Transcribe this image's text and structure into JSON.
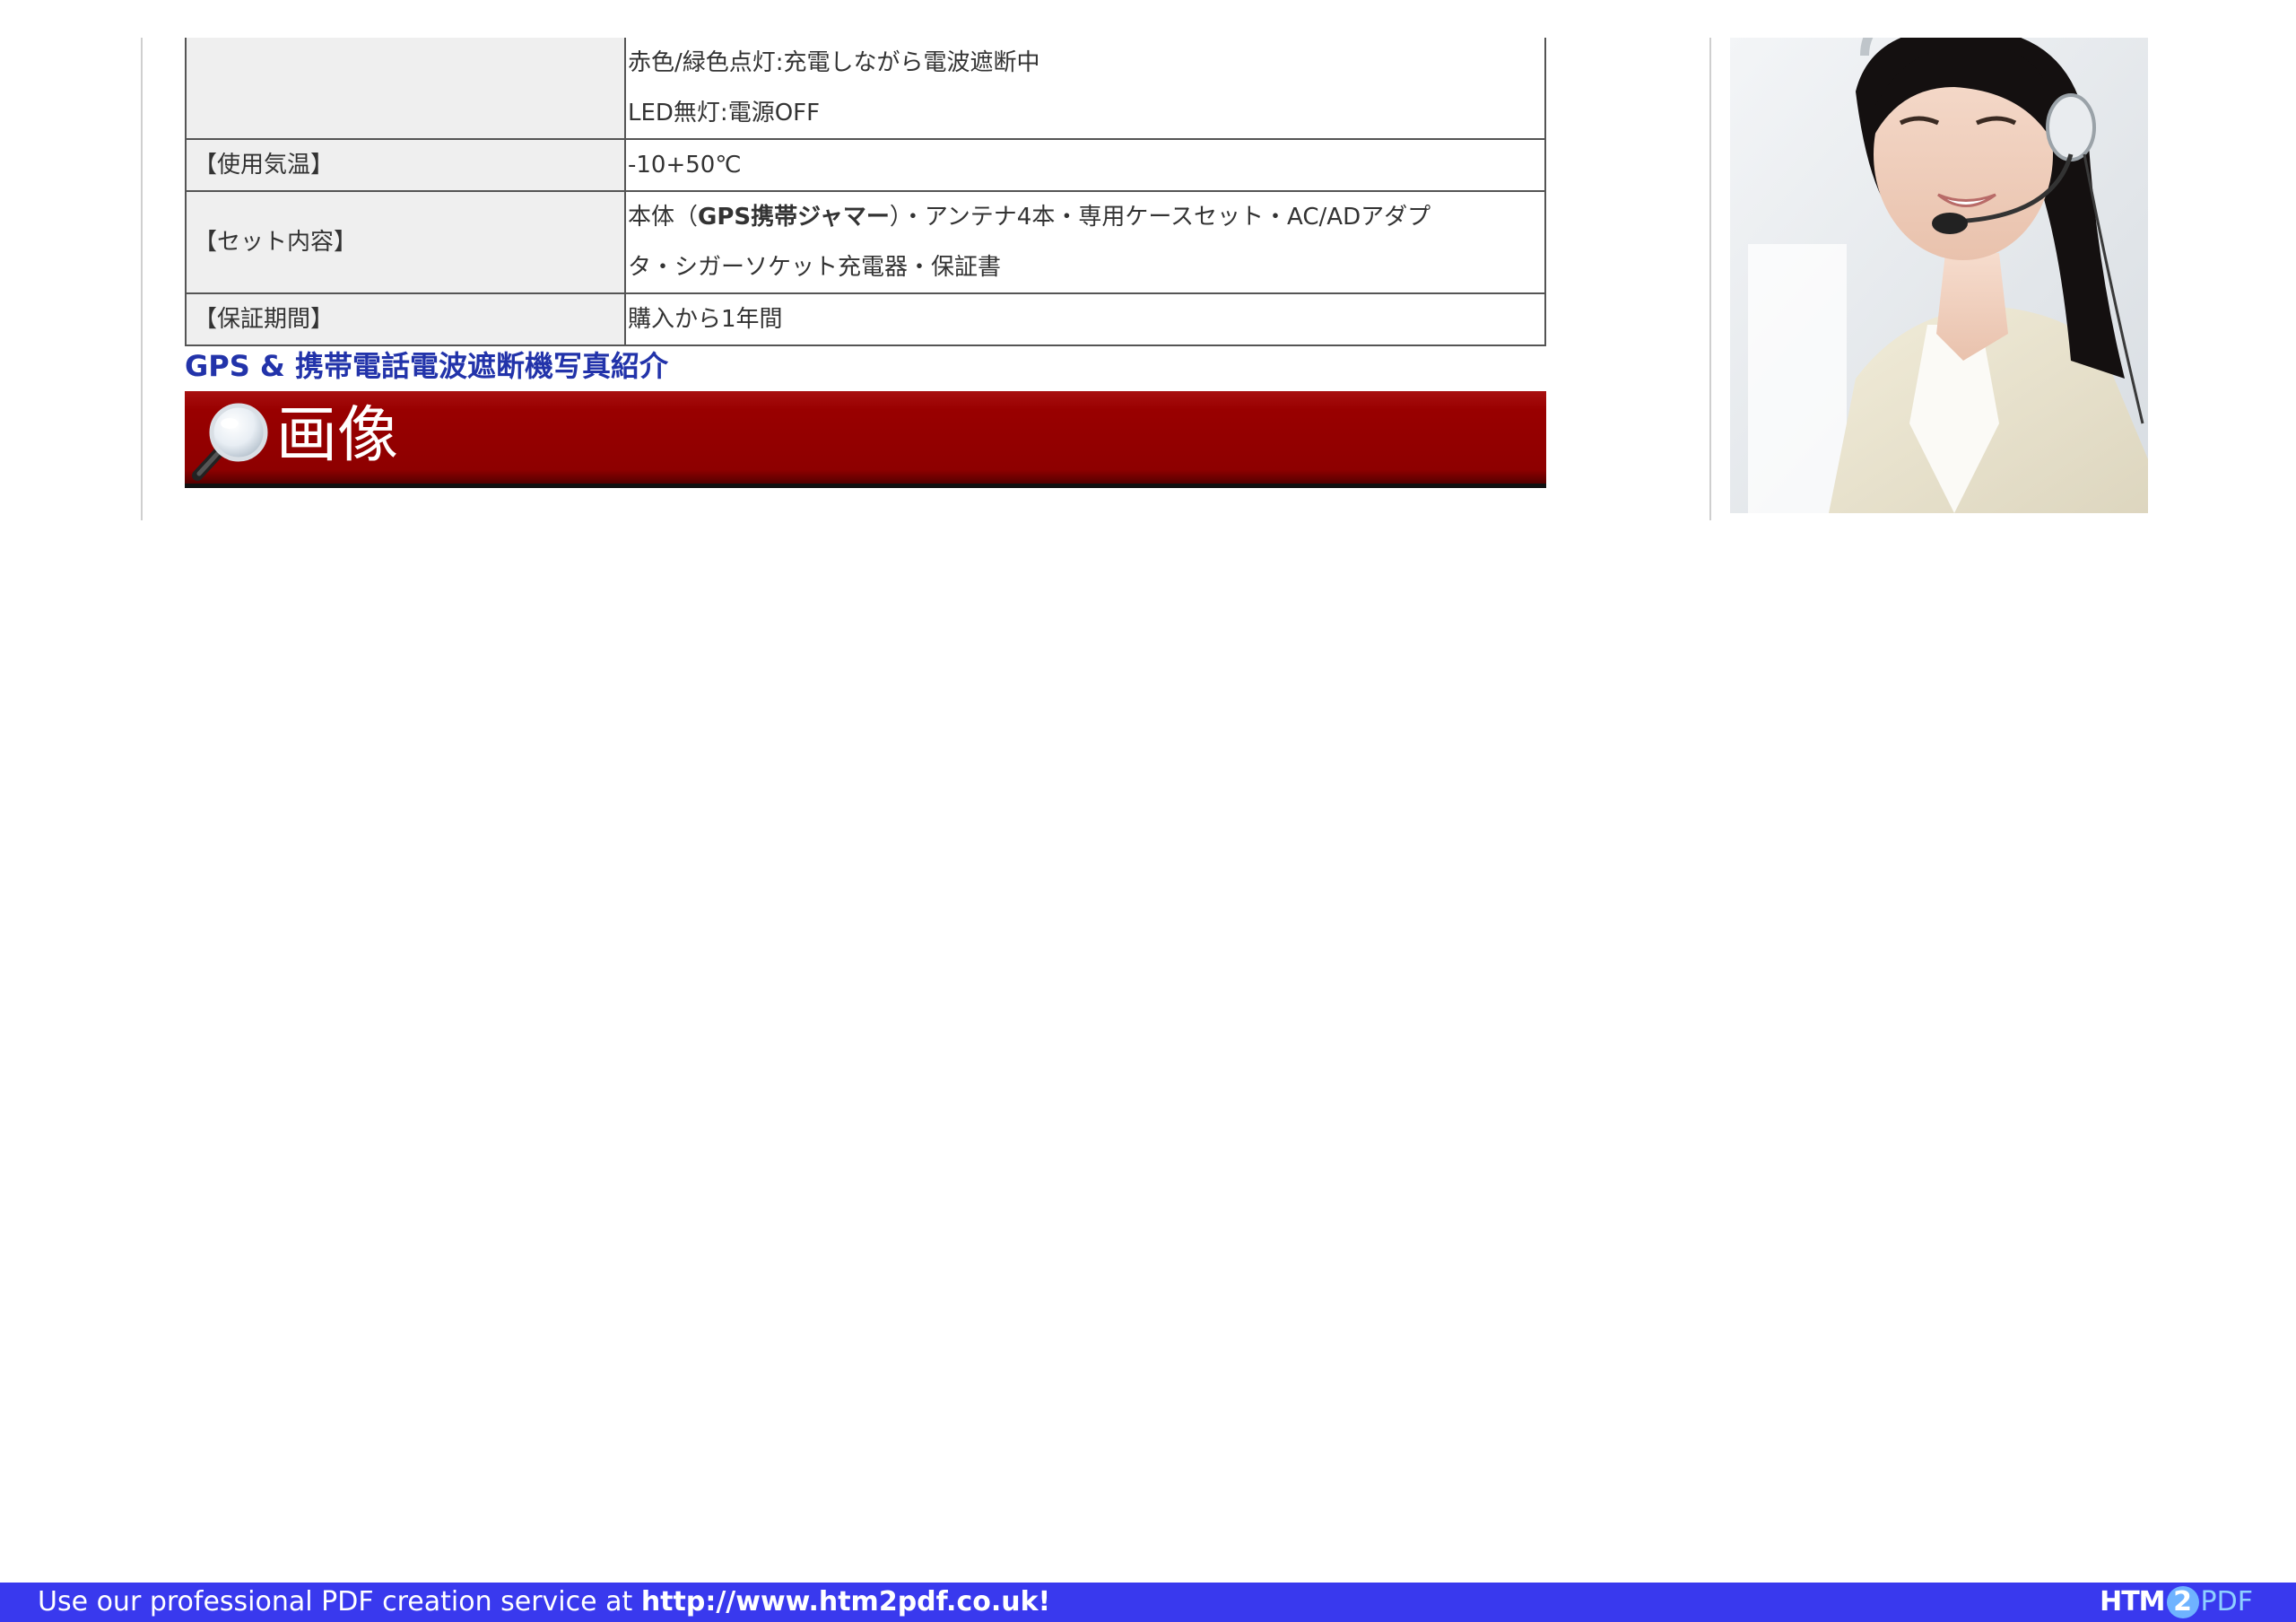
{
  "spec_table": {
    "rows": [
      {
        "label": "",
        "lines": [
          "赤色/緑色点灯:充電しながら電波遮断中",
          "LED無灯:電源OFF"
        ]
      },
      {
        "label": "【使用気温】",
        "lines": [
          "-10+50℃"
        ]
      },
      {
        "label": "【セット内容】",
        "line1_prefix": "本体（",
        "line1_bold": "GPS携帯ジャマー",
        "line1_suffix": "）・アンテナ4本・専用ケースセット・AC/ADアダプ",
        "line2": "タ・シガーソケット充電器・保証書"
      },
      {
        "label": "【保証期間】",
        "lines": [
          "購入から1年間"
        ]
      }
    ]
  },
  "section_link": "GPS & 携帯電話電波遮断機写真紹介",
  "banner": {
    "icon": "magnifier-icon",
    "title": "画像",
    "color": "#990000"
  },
  "photo": {
    "subject": "support-operator-with-headset"
  },
  "footer": {
    "text": "Use our professional PDF creation service at ",
    "url": "http://www.htm2pdf.co.uk!",
    "logo_htm": "HTM",
    "logo_2": "2",
    "logo_pdf": "PDF",
    "color": "#3939ee"
  }
}
